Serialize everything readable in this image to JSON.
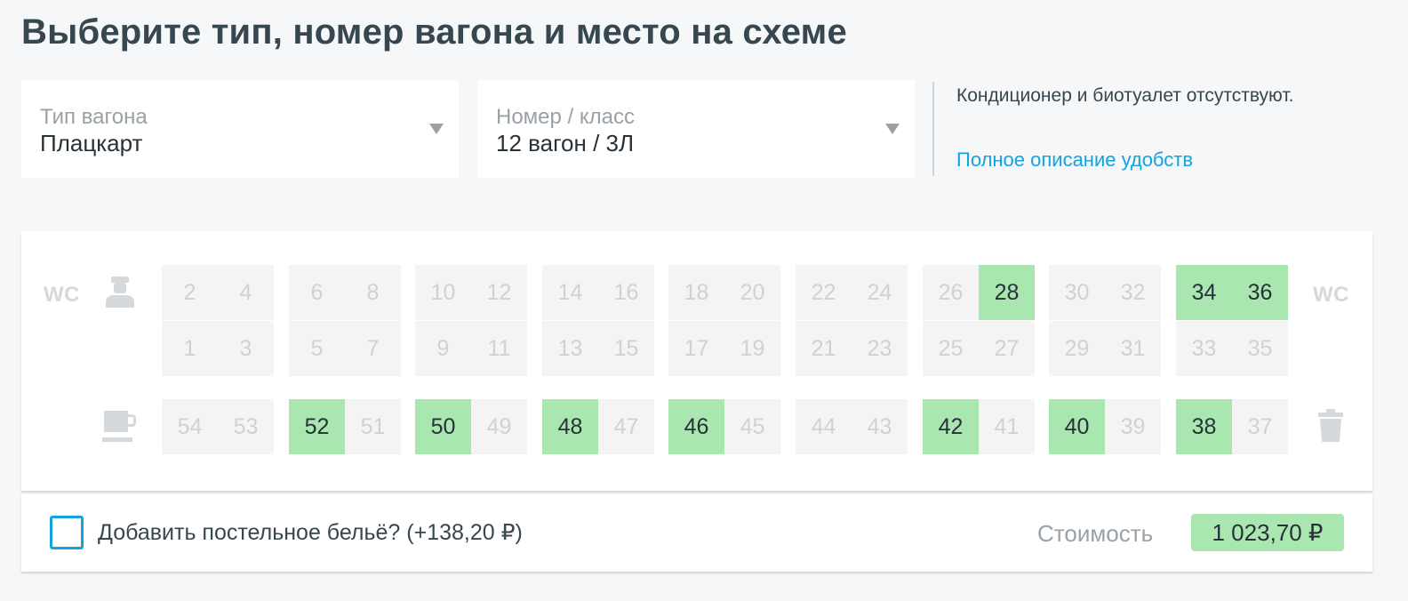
{
  "page": {
    "title": "Выберите тип, номер вагона и место на схеме"
  },
  "car_type_select": {
    "label": "Тип вагона",
    "value": "Плацкарт"
  },
  "car_number_select": {
    "label": "Номер / класс",
    "value": "12 вагон / 3Л"
  },
  "amenities": {
    "text": "Кондиционер и биотуалет отсутствуют.",
    "link": "Полное описание удобств"
  },
  "scheme": {
    "wc_left": "WC",
    "wc_right": "WC",
    "icons": [
      "conductor-icon",
      "cup-icon",
      "trash-icon"
    ],
    "upper_row": [
      "2",
      "4",
      "6",
      "8",
      "10",
      "12",
      "14",
      "16",
      "18",
      "20",
      "22",
      "24",
      "26",
      "28",
      "30",
      "32",
      "34",
      "36"
    ],
    "lower_row": [
      "1",
      "3",
      "5",
      "7",
      "9",
      "11",
      "13",
      "15",
      "17",
      "19",
      "21",
      "23",
      "25",
      "27",
      "29",
      "31",
      "33",
      "35"
    ],
    "side_row": [
      "54",
      "53",
      "52",
      "51",
      "50",
      "49",
      "48",
      "47",
      "46",
      "45",
      "44",
      "43",
      "42",
      "41",
      "40",
      "39",
      "38",
      "37"
    ],
    "available_seats": [
      "28",
      "34",
      "36",
      "52",
      "50",
      "48",
      "46",
      "42",
      "40",
      "38"
    ]
  },
  "footer": {
    "bedding_label": "Добавить постельное бельё? (+138,20 ₽)",
    "bedding_checked": false,
    "price_label": "Стоимость",
    "price_value": "1 023,70 ₽"
  },
  "colors": {
    "accent": "#12a3e0",
    "available_seat": "#a9e6b0",
    "unavailable_seat": "#f4f4f4",
    "title": "#37474f"
  }
}
